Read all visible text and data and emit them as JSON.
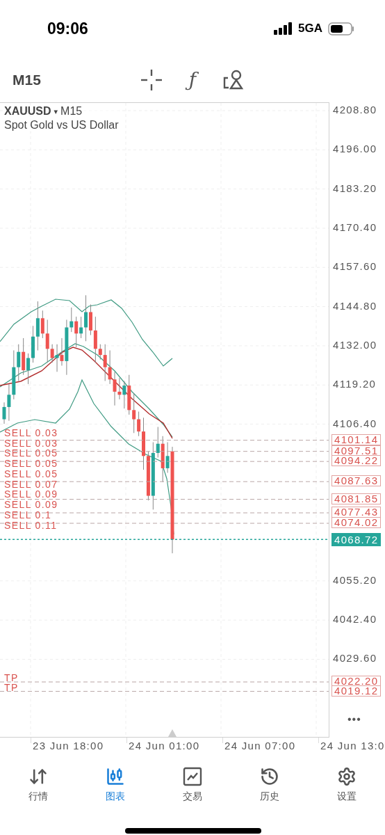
{
  "status_bar": {
    "time": "09:06",
    "network": "5GA"
  },
  "toolbar": {
    "timeframe": "M15",
    "function_icon": "ƒ"
  },
  "chart": {
    "symbol": "XAUUSD",
    "symbol_caret": "▾",
    "timeframe": "M15",
    "description": "Spot Gold vs US Dollar",
    "price_axis": [
      "4208.80",
      "4196.00",
      "4183.20",
      "4170.40",
      "4157.60",
      "4144.80",
      "4132.00",
      "4119.20",
      "4106.40",
      "4055.20",
      "4042.40",
      "4029.60"
    ],
    "sell_labels": [
      "SELL 0.03",
      "SELL 0.03",
      "SELL 0.05",
      "SELL 0.05",
      "SELL 0.05",
      "SELL 0.07",
      "SELL 0.09",
      "SELL 0.09",
      "SELL 0.1",
      "SELL 0.11"
    ],
    "order_prices": [
      "4101.14",
      "4097.51",
      "4094.22",
      "4087.63",
      "4081.85",
      "4077.43",
      "4074.02"
    ],
    "take_profits": [
      {
        "label": "TP",
        "price": "4022.20"
      },
      {
        "label": "TP",
        "price": "4019.12"
      }
    ],
    "current_price": "4068.72",
    "more": "•••",
    "time_axis": [
      "23 Jun 18:00",
      "24 Jun 01:00",
      "24 Jun 07:00",
      "24 Jun 13:0"
    ]
  },
  "tabs": [
    {
      "label": "行情",
      "kind": "quotes",
      "selected": false
    },
    {
      "label": "图表",
      "kind": "chart",
      "selected": true
    },
    {
      "label": "交易",
      "kind": "trade",
      "selected": false
    },
    {
      "label": "历史",
      "kind": "history",
      "selected": false
    },
    {
      "label": "设置",
      "kind": "settings",
      "selected": false
    }
  ]
}
